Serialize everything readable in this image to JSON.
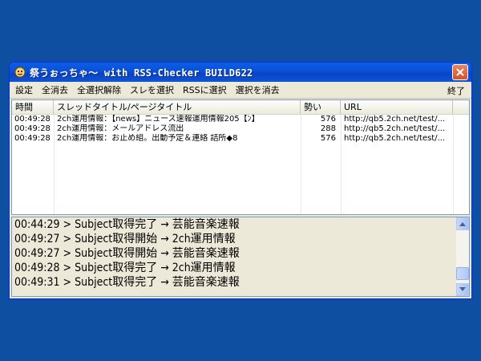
{
  "window": {
    "title": "祭うぉっちゃ〜 with RSS-Checker BUILD622",
    "icon": "app-icon",
    "close_icon": "close-icon"
  },
  "menu": {
    "items": [
      "設定",
      "全消去",
      "全選択解除",
      "スレを選択",
      "RSSに選択",
      "選択を消去"
    ],
    "right": "終了"
  },
  "list": {
    "columns": [
      "時間",
      "スレッドタイトル/ページタイトル",
      "勢い",
      "URL"
    ],
    "rows": [
      {
        "time": "00:49:28",
        "title": "2ch運用情報：【news】ニュース速報運用情報205【ﾝ】",
        "count": "576",
        "url": "http://qb5.2ch.net/test/..."
      },
      {
        "time": "00:49:28",
        "title": "2ch運用情報：メールアドレス流出",
        "count": "288",
        "url": "http://qb5.2ch.net/test/..."
      },
      {
        "time": "00:49:28",
        "title": "2ch運用情報：お止め組。出動予定＆連絡 詰所◆8",
        "count": "576",
        "url": "http://qb5.2ch.net/test/..."
      }
    ]
  },
  "log": {
    "lines": [
      "00:44:29 > Subject取得完了 → 芸能音楽速報",
      "00:49:27 > Subject取得開始 → 2ch運用情報",
      "00:49:27 > Subject取得開始 → 芸能音楽速報",
      "00:49:28 > Subject取得完了 → 2ch運用情報",
      "00:49:31 > Subject取得完了 → 芸能音楽速報"
    ]
  },
  "colors": {
    "desktop": "#0e4fa1",
    "titlebar": "#0b4fd6",
    "close": "#d9502a"
  }
}
